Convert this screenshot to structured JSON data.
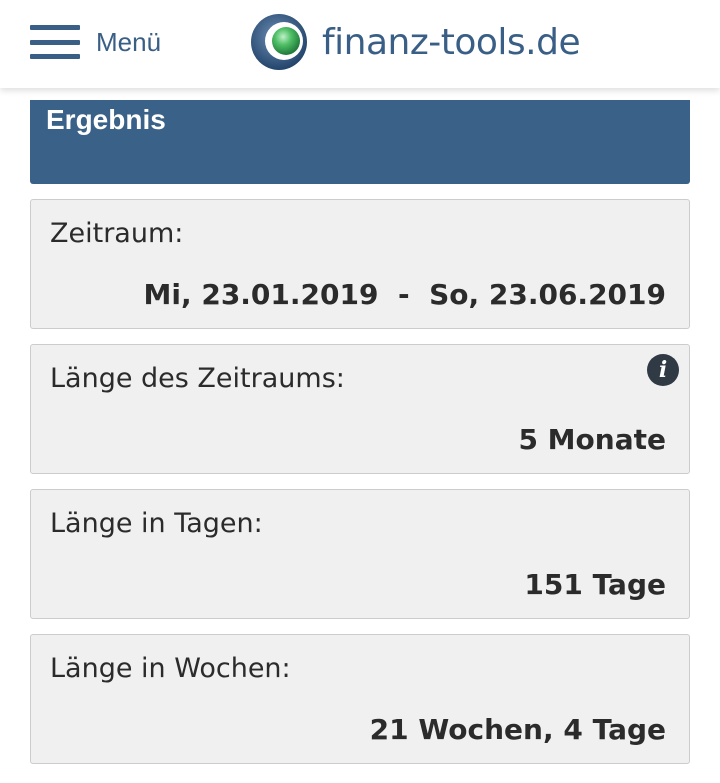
{
  "header": {
    "menu_label": "Menü",
    "site_name": "finanz-tools.de"
  },
  "result": {
    "title": "Ergebnis"
  },
  "cards": [
    {
      "label": "Zeitraum:",
      "value": "Mi, 23.01.2019  -  So, 23.06.2019"
    },
    {
      "label": "Länge des Zeitraums:",
      "value": "5 Monate",
      "icon": "info-icon"
    },
    {
      "label": "Länge in Tagen:",
      "value": "151 Tage"
    },
    {
      "label": "Länge in Wochen:",
      "value": "21 Wochen, 4 Tage"
    }
  ],
  "colors": {
    "brand": "#3a5f86",
    "header_bar": "#3a6187",
    "card_bg": "#f0f0f0",
    "logo_green": "#3fae5a"
  }
}
